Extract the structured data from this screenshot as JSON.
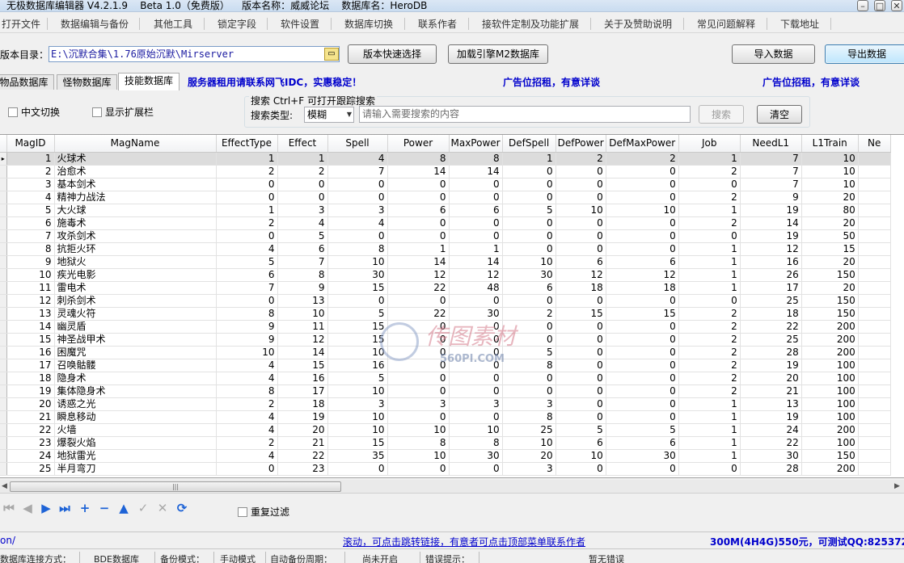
{
  "title": {
    "app": "无极数据库编辑器 V4.2.1.9",
    "beta": "Beta 1.0（免费版）",
    "version_name": "版本名称：威威论坛",
    "db_name": "数据库名：HeroDB"
  },
  "menu": [
    "打开文件",
    "数据编辑与备份",
    "其他工具",
    "锁定字段",
    "软件设置",
    "数据库切换",
    "联系作者",
    "接软件定制及功能扩展",
    "关于及赞助说明",
    "常见问题解释",
    "下载地址"
  ],
  "toolbar": {
    "dir_label": "版本目录：",
    "dir_value": "E:\\沉默合集\\1.76原始沉默\\Mirserver",
    "quick_select": "版本快速选择",
    "load_m2": "加载引擎M2数据库",
    "import": "导入数据",
    "export": "导出数据"
  },
  "tabs": [
    "物品数据库",
    "怪物数据库",
    "技能数据库"
  ],
  "active_tab": 2,
  "ads": {
    "server": "服务器租用请联系网飞IDC，实惠稳定！",
    "ad1": "广告位招租，有意详谈",
    "ad2": "广告位招租，有意详谈"
  },
  "options": {
    "chinese_switch": "中文切换",
    "show_ext": "显示扩展栏"
  },
  "search": {
    "title": "搜索  Ctrl+F 可打开跟踪搜索",
    "type_label": "搜索类型:",
    "type_value": "模糊",
    "placeholder": "请输入需要搜索的内容",
    "search_btn": "搜索",
    "clear_btn": "清空"
  },
  "grid": {
    "columns": [
      "MagID",
      "MagName",
      "EffectType",
      "Effect",
      "Spell",
      "Power",
      "MaxPower",
      "DefSpell",
      "DefPower",
      "DefMaxPower",
      "Job",
      "NeedL1",
      "L1Train",
      "Ne"
    ],
    "rows": [
      [
        1,
        "火球术",
        1,
        1,
        4,
        8,
        8,
        1,
        2,
        2,
        1,
        7,
        10
      ],
      [
        2,
        "治愈术",
        2,
        2,
        7,
        14,
        14,
        0,
        0,
        0,
        2,
        7,
        10
      ],
      [
        3,
        "基本剑术",
        0,
        0,
        0,
        0,
        0,
        0,
        0,
        0,
        0,
        7,
        10
      ],
      [
        4,
        "精神力战法",
        0,
        0,
        0,
        0,
        0,
        0,
        0,
        0,
        2,
        9,
        20
      ],
      [
        5,
        "大火球",
        1,
        3,
        3,
        6,
        6,
        5,
        10,
        10,
        1,
        19,
        80
      ],
      [
        6,
        "施毒术",
        2,
        4,
        4,
        0,
        0,
        0,
        0,
        0,
        2,
        14,
        20
      ],
      [
        7,
        "攻杀剑术",
        0,
        5,
        0,
        0,
        0,
        0,
        0,
        0,
        0,
        19,
        50
      ],
      [
        8,
        "抗拒火环",
        4,
        6,
        8,
        1,
        1,
        0,
        0,
        0,
        1,
        12,
        15
      ],
      [
        9,
        "地狱火",
        5,
        7,
        10,
        14,
        14,
        10,
        6,
        6,
        1,
        16,
        20
      ],
      [
        10,
        "疾光电影",
        6,
        8,
        30,
        12,
        12,
        30,
        12,
        12,
        1,
        26,
        150
      ],
      [
        11,
        "雷电术",
        7,
        9,
        15,
        22,
        48,
        6,
        18,
        18,
        1,
        17,
        20
      ],
      [
        12,
        "刺杀剑术",
        0,
        13,
        0,
        0,
        0,
        0,
        0,
        0,
        0,
        25,
        150
      ],
      [
        13,
        "灵魂火符",
        8,
        10,
        5,
        22,
        30,
        2,
        15,
        15,
        2,
        18,
        150
      ],
      [
        14,
        "幽灵盾",
        9,
        11,
        15,
        0,
        0,
        0,
        0,
        0,
        2,
        22,
        200
      ],
      [
        15,
        "神圣战甲术",
        9,
        12,
        15,
        0,
        0,
        0,
        0,
        0,
        2,
        25,
        200
      ],
      [
        16,
        "困魔咒",
        10,
        14,
        10,
        0,
        0,
        5,
        0,
        0,
        2,
        28,
        200
      ],
      [
        17,
        "召唤骷髅",
        4,
        15,
        16,
        0,
        0,
        8,
        0,
        0,
        2,
        19,
        100
      ],
      [
        18,
        "隐身术",
        4,
        16,
        5,
        0,
        0,
        0,
        0,
        0,
        2,
        20,
        100
      ],
      [
        19,
        "集体隐身术",
        8,
        17,
        10,
        0,
        0,
        0,
        0,
        0,
        2,
        21,
        100
      ],
      [
        20,
        "诱惑之光",
        2,
        18,
        3,
        3,
        3,
        3,
        0,
        0,
        1,
        13,
        100
      ],
      [
        21,
        "瞬息移动",
        4,
        19,
        10,
        0,
        0,
        8,
        0,
        0,
        1,
        19,
        100
      ],
      [
        22,
        "火墙",
        4,
        20,
        10,
        10,
        10,
        25,
        5,
        5,
        1,
        24,
        200
      ],
      [
        23,
        "爆裂火焰",
        2,
        21,
        15,
        8,
        8,
        10,
        6,
        6,
        1,
        22,
        100
      ],
      [
        24,
        "地狱雷光",
        4,
        22,
        35,
        10,
        30,
        20,
        10,
        30,
        1,
        30,
        150
      ],
      [
        25,
        "半月弯刀",
        0,
        23,
        0,
        0,
        0,
        3,
        0,
        0,
        0,
        28,
        200
      ]
    ]
  },
  "watermark": {
    "cn": "传图素材",
    "en": "560PI.COM"
  },
  "bottom_tools": {
    "dedupe": "重复过滤"
  },
  "status": {
    "left": "on/",
    "scroll": "滚动，可点击跳转链接，有意者可点击顶部菜单联系作者",
    "right": "300M(4H4G)550元，可测试QQ:825372"
  },
  "statusbar": [
    "数据库连接方式：",
    "BDE数据库",
    "备份模式：",
    "手动模式",
    "自动备份周期：",
    "尚未开启",
    "错误提示：",
    "暂无错误"
  ],
  "colors": {
    "ad_blue": "#0000cc",
    "nav_blue": "#1e63d6",
    "selected_row": "#dcdcdc"
  }
}
